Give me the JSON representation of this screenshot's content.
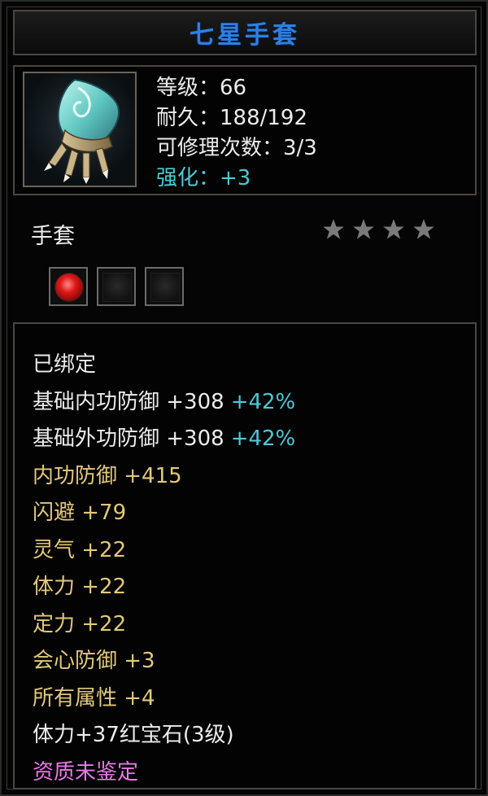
{
  "item": {
    "name": "七星手套",
    "type": "手套",
    "level": "等级：66",
    "durability": "耐久：188/192",
    "repairs": "可修理次数：3/3",
    "enhance": "强化：+3",
    "star_count": 4
  },
  "sockets": [
    {
      "state": "filled",
      "gem": "ruby-gem-icon"
    },
    {
      "state": "empty"
    },
    {
      "state": "empty"
    }
  ],
  "attributes": {
    "bound": "已绑定",
    "base_inner_def": "基础内功防御 +308",
    "base_inner_def_pct": "+42%",
    "base_outer_def": "基础外功防御 +308",
    "base_outer_def_pct": "+42%",
    "inner_def": "内功防御 +415",
    "dodge": "闪避 +79",
    "spirit": "灵气 +22",
    "stamina": "体力 +22",
    "focus": "定力 +22",
    "crit_def": "会心防御 +3",
    "all_attr": "所有属性 +4",
    "gem_bonus": "体力+37红宝石(3级)",
    "quality": "资质未鉴定"
  },
  "colors": {
    "title": "#2f7fe0",
    "enhance": "#4ec8d8",
    "bonus_attr": "#e2c87a",
    "quality": "#e67ae6",
    "star": "#7a7a7a"
  }
}
